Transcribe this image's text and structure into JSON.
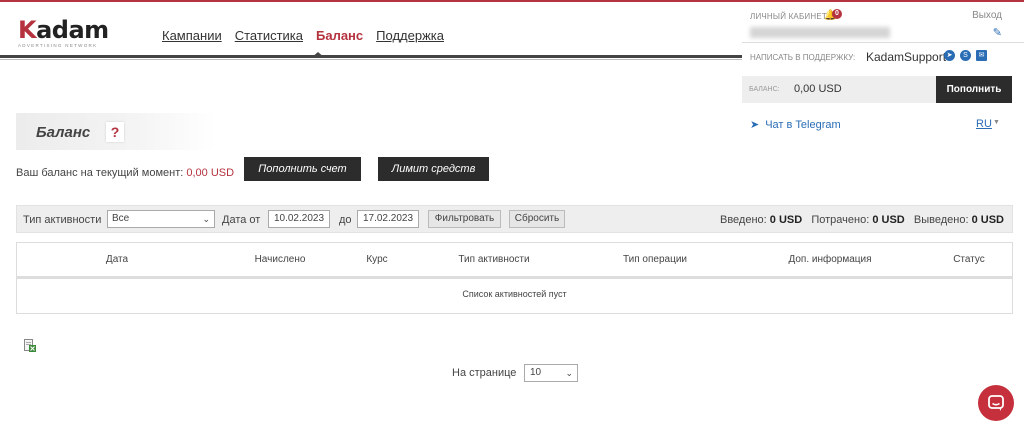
{
  "header": {
    "logo": "Kadam",
    "logo_sub": "ADVERTISING NETWORK",
    "nav": [
      {
        "label": "Кампании",
        "active": false
      },
      {
        "label": "Статистика",
        "active": false
      },
      {
        "label": "Баланс",
        "active": true
      },
      {
        "label": "Поддержка",
        "active": false
      }
    ]
  },
  "account": {
    "cabinet_label": "ЛИЧНЫЙ КАБИНЕТ",
    "notif_count": "0",
    "logout": "Выход",
    "support_label": "НАПИСАТЬ В ПОДДЕРЖКУ:",
    "support_name": "KadamSupport",
    "balance_label": "БАЛАНС:",
    "balance_value": "0,00 USD",
    "topup_label": "Пополнить",
    "telegram_chat": "Чат в Telegram",
    "language": "RU"
  },
  "page": {
    "title": "Баланс",
    "help": "?",
    "balance_text": "Ваш баланс на текущий момент:",
    "balance_value": "0,00 USD",
    "topup_account": "Пополнить счет",
    "funds_limit": "Лимит средств"
  },
  "filter": {
    "activity_label": "Тип активности",
    "activity_value": "Все",
    "date_from_label": "Дата от",
    "date_from": "10.02.2023",
    "date_to_label": "до",
    "date_to": "17.02.2023",
    "filter_btn": "Фильтровать",
    "reset_btn": "Сбросить",
    "entered_label": "Введено:",
    "entered_value": "0 USD",
    "spent_label": "Потрачено:",
    "spent_value": "0 USD",
    "withdrawn_label": "Выведено:",
    "withdrawn_value": "0 USD"
  },
  "table": {
    "columns": [
      "Дата",
      "Начислено",
      "Курс",
      "Тип активности",
      "Тип операции",
      "Доп. информация",
      "Статус"
    ],
    "empty": "Список активностей пуст"
  },
  "pager": {
    "label": "На странице",
    "value": "10"
  },
  "colors": {
    "brand": "#b5323f",
    "dark_button": "#2c2c2c",
    "link": "#2a6db5"
  }
}
